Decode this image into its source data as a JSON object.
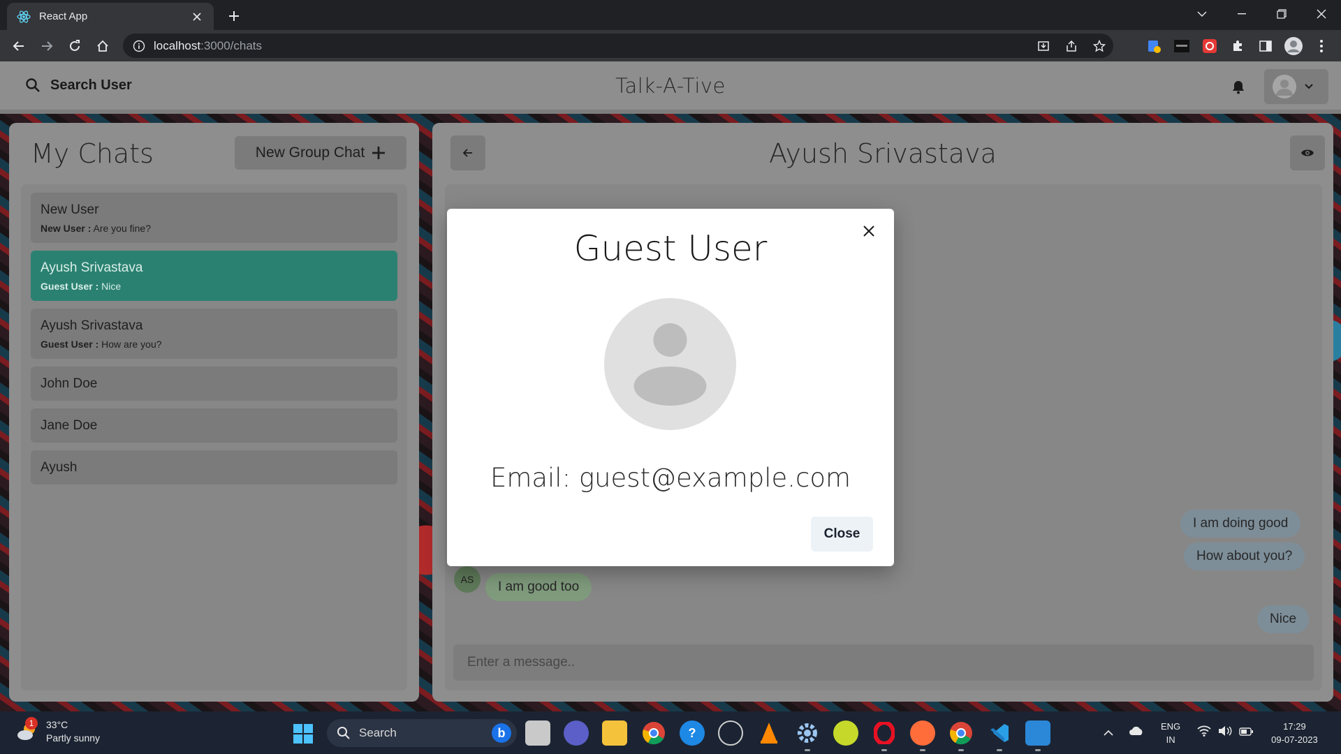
{
  "browser": {
    "tab_title": "React App",
    "url_host": "localhost",
    "url_path": ":3000/chats"
  },
  "app": {
    "search_label": "Search User",
    "title": "Talk-A-Tive"
  },
  "left_panel": {
    "heading": "My Chats",
    "new_group_label": "New Group Chat",
    "chats": [
      {
        "name": "New User",
        "sender": "New User :",
        "message": "Are you fine?"
      },
      {
        "name": "Ayush Srivastava",
        "sender": "Guest User :",
        "message": "Nice",
        "active": true
      },
      {
        "name": "Ayush Srivastava",
        "sender": "Guest User :",
        "message": "How are you?"
      },
      {
        "name": "John Doe"
      },
      {
        "name": "Jane Doe"
      },
      {
        "name": "Ayush"
      }
    ]
  },
  "chat": {
    "title": "Ayush Srivastava",
    "messages": [
      {
        "text": "I am doing good",
        "mine": true
      },
      {
        "text": "How about you?",
        "mine": true
      },
      {
        "text": "I am good too",
        "mine": false,
        "avatar": "AS"
      },
      {
        "text": "Nice",
        "mine": true
      }
    ],
    "input_placeholder": "Enter a message.."
  },
  "modal": {
    "title": "Guest User",
    "email": "Email: guest@example.com",
    "close_label": "Close"
  },
  "taskbar": {
    "temperature": "33°C",
    "weather": "Partly sunny",
    "weather_badge": "1",
    "search_label": "Search",
    "lang_top": "ENG",
    "lang_bottom": "IN",
    "time": "17:29",
    "date": "09-07-2023"
  },
  "colors": {
    "active_chat": "#2b8171",
    "mine_bubble": "#7d8e99",
    "theirs_bubble": "#7f9b7c"
  }
}
